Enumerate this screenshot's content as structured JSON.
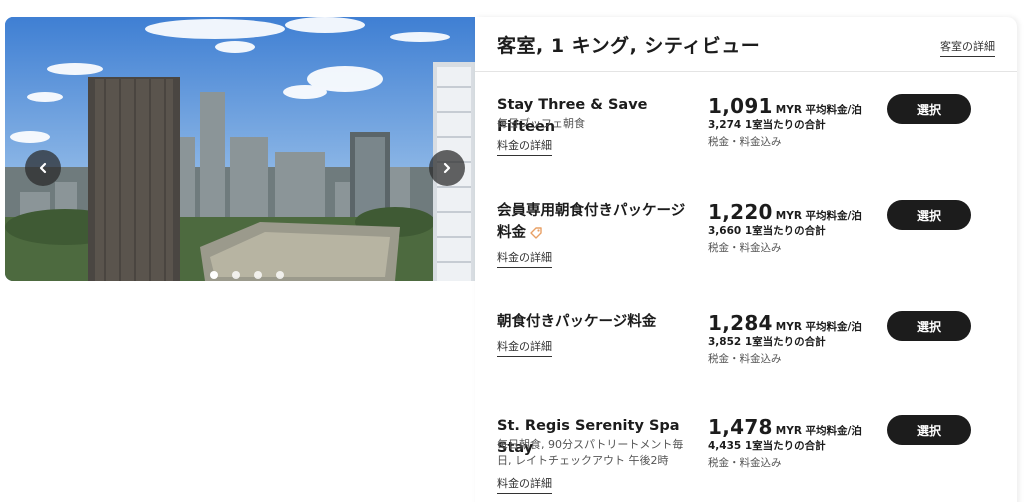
{
  "gallery": {
    "prev_icon": "chevron-left-icon",
    "next_icon": "chevron-right-icon",
    "slide_count": 4,
    "active_slide": 1
  },
  "room": {
    "title": "客室, 1 キング, シティビュー",
    "details_link": "客室の詳細"
  },
  "rates": [
    {
      "name": "Stay Three & Save Fifteen",
      "sub": "毎日ブッフェ朝食",
      "link": "料金の詳細",
      "price": "1,091",
      "unit": "MYR 平均料金/泊",
      "total": "3,274 1室当たりの合計",
      "tax": "税金・料金込み",
      "button": "選択"
    },
    {
      "name": "会員専用朝食付きパッケージ料金",
      "tag_icon": "member-tag-icon",
      "link": "料金の詳細",
      "price": "1,220",
      "unit": "MYR 平均料金/泊",
      "total": "3,660 1室当たりの合計",
      "tax": "税金・料金込み",
      "button": "選択"
    },
    {
      "name": "朝食付きパッケージ料金",
      "link": "料金の詳細",
      "price": "1,284",
      "unit": "MYR 平均料金/泊",
      "total": "3,852 1室当たりの合計",
      "tax": "税金・料金込み",
      "button": "選択"
    },
    {
      "name": "St. Regis Serenity Spa Stay",
      "sub": "毎日朝食, 90分スパトリートメント毎日, レイトチェックアウト 午後2時",
      "link": "料金の詳細",
      "price": "1,478",
      "unit": "MYR 平均料金/泊",
      "total": "4,435 1室当たりの合計",
      "tax": "税金・料金込み",
      "button": "選択"
    }
  ],
  "colors": {
    "button_bg": "#1c1c1c",
    "text_primary": "#1c1c1c",
    "text_secondary": "#555555",
    "tag_accent": "#e8a065"
  }
}
